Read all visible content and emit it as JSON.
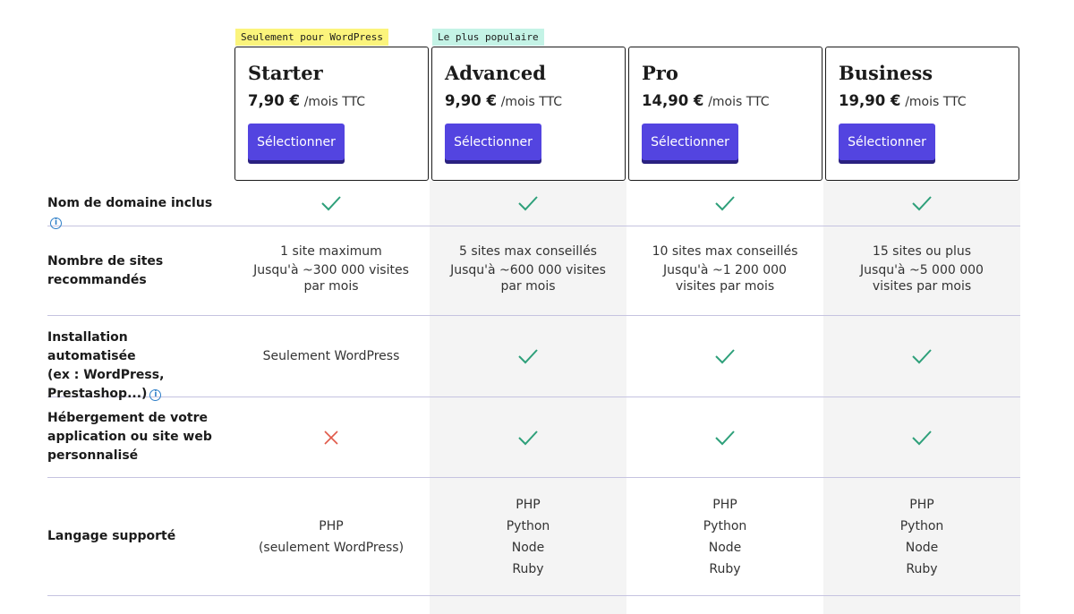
{
  "badges": {
    "starter": "Seulement pour WordPress",
    "advanced": "Le plus populaire"
  },
  "plans": [
    {
      "name": "Starter",
      "price": "7,90 €",
      "suffix": "/mois TTC",
      "button": "Sélectionner"
    },
    {
      "name": "Advanced",
      "price": "9,90 €",
      "suffix": "/mois TTC",
      "button": "Sélectionner"
    },
    {
      "name": "Pro",
      "price": "14,90 €",
      "suffix": "/mois TTC",
      "button": "Sélectionner"
    },
    {
      "name": "Business",
      "price": "19,90 €",
      "suffix": "/mois TTC",
      "button": "Sélectionner"
    }
  ],
  "rows": {
    "domain": {
      "label": "Nom de domaine inclus",
      "info_icon": "i"
    },
    "sites": {
      "label": "Nombre de sites recommandés",
      "starter": {
        "line1": "1 site maximum",
        "line2": "Jusqu'à ~300 000 visites",
        "line3": "par mois"
      },
      "advanced": {
        "line1": "5 sites max conseillés",
        "line2": "Jusqu'à ~600 000 visites",
        "line3": "par mois"
      },
      "pro": {
        "line1": "10 sites max conseillés",
        "line2": "Jusqu'à ~1 200 000",
        "line3": "visites par mois"
      },
      "business": {
        "line1": "15 sites ou plus",
        "line2": "Jusqu'à ~5 000 000",
        "line3": "visites par mois"
      }
    },
    "install": {
      "label_line1": "Installation automatisée",
      "label_line2": "(ex : WordPress,",
      "label_line3": "Prestashop...)",
      "info_icon": "i",
      "starter": "Seulement WordPress"
    },
    "hosting": {
      "label_line1": "Hébergement de votre",
      "label_line2": "application ou site web",
      "label_line3": "personnalisé"
    },
    "language": {
      "label": "Langage supporté",
      "starter": {
        "line1": "PHP",
        "line2": "(seulement WordPress)"
      },
      "others": [
        "PHP",
        "Python",
        "Node",
        "Ruby"
      ]
    }
  },
  "icons": {
    "check": "check-icon",
    "cross": "cross-icon",
    "info": "info-icon"
  },
  "colors": {
    "accent": "#5344e0",
    "check": "#2ea07a",
    "cross": "#e05a4a",
    "info": "#2f7fc8",
    "badge_yellow": "#fbf47c",
    "badge_green": "#c4f3e6"
  }
}
